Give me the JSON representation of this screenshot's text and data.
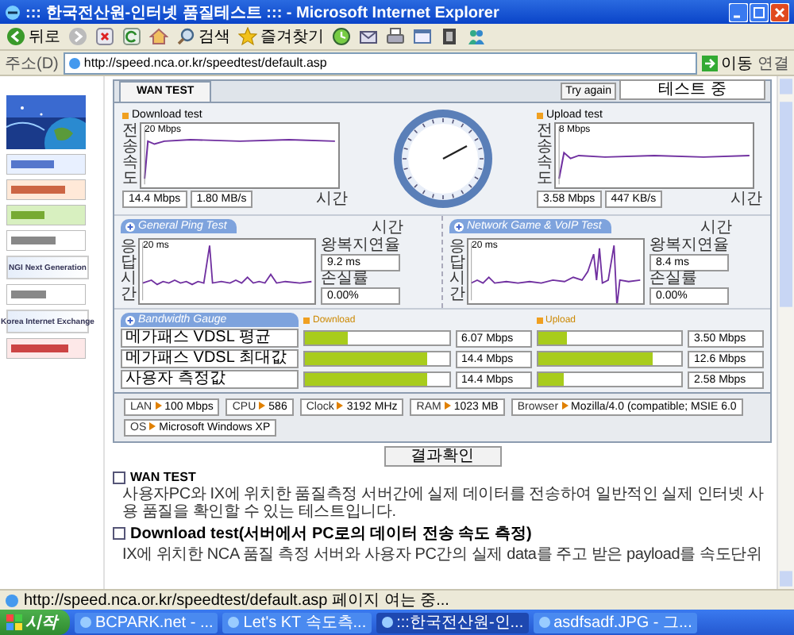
{
  "window": {
    "title": "::: 한국전산원-인터넷 품질테스트 ::: - Microsoft Internet Explorer"
  },
  "toolbar": {
    "items": [
      {
        "kind": "back",
        "label": "뒤로"
      },
      {
        "kind": "forward"
      },
      {
        "kind": "stop"
      },
      {
        "kind": "refresh"
      },
      {
        "kind": "home"
      },
      {
        "kind": "search",
        "label": "검색"
      },
      {
        "kind": "favorites",
        "label": "즐겨찾기"
      },
      {
        "kind": "history"
      },
      {
        "kind": "mail"
      },
      {
        "kind": "print"
      },
      {
        "kind": "edit"
      },
      {
        "kind": "media"
      },
      {
        "kind": "messenger"
      }
    ]
  },
  "address_bar": {
    "label": "주소(D)",
    "url": "http://speed.nca.or.kr/speedtest/default.asp",
    "go": "이동",
    "links": "연결"
  },
  "sidebar": {
    "banners": [
      {
        "kind": "picture"
      },
      {
        "kind": "banner"
      },
      {
        "kind": "banner"
      },
      {
        "kind": "banner"
      },
      {
        "kind": "banner"
      },
      {
        "kind": "banner",
        "text": "NGI Next Generation"
      },
      {
        "kind": "banner"
      },
      {
        "kind": "banner",
        "text": "Korea Internet Exchange"
      },
      {
        "kind": "banner"
      }
    ]
  },
  "test": {
    "tab": "WAN TEST",
    "retry": "Try again",
    "status": "테스트 중",
    "download": {
      "title": "Download test",
      "axis": "전송속도",
      "max": "20 Mbps",
      "xlabel": "시간",
      "speed": "14.4 Mbps",
      "rate": "1.80 MB/s"
    },
    "upload": {
      "title": "Upload test",
      "axis": "전송속도",
      "max": "8 Mbps",
      "xlabel": "시간",
      "speed": "3.58 Mbps",
      "rate": "447 KB/s"
    },
    "ping": [
      {
        "title": "General Ping Test",
        "axis": "응답시간",
        "max": "20 ms",
        "xlabel": "시간",
        "latency_label": "왕복지연율",
        "latency": "9.2 ms",
        "loss_label": "손실률",
        "loss": "0.00%"
      },
      {
        "title": "Network Game & VoIP Test",
        "axis": "응답시간",
        "max": "20 ms",
        "xlabel": "시간",
        "latency_label": "왕복지연율",
        "latency": "8.4 ms",
        "loss_label": "손실률",
        "loss": "0.00%"
      }
    ],
    "bandwidth": {
      "title": "Bandwidth Gauge",
      "download_header": "Download",
      "upload_header": "Upload",
      "rows": [
        {
          "name": "메가패스 VDSL 평균",
          "download": {
            "level": 0.3,
            "reading": "6.07 Mbps"
          },
          "upload": {
            "level": 0.2,
            "reading": "3.50 Mbps"
          }
        },
        {
          "name": "메가패스 VDSL 최대값",
          "download": {
            "level": 0.85,
            "reading": "14.4 Mbps"
          },
          "upload": {
            "level": 0.8,
            "reading": "12.6 Mbps"
          }
        },
        {
          "name": "사용자 측정값",
          "download": {
            "level": 0.85,
            "reading": "14.4 Mbps"
          },
          "upload": {
            "level": 0.18,
            "reading": "2.58 Mbps"
          }
        }
      ]
    },
    "system": [
      {
        "label": "LAN",
        "value": "100 Mbps"
      },
      {
        "label": "CPU",
        "value": "586"
      },
      {
        "label": "Clock",
        "value": "3192 MHz"
      },
      {
        "label": "RAM",
        "value": "1023 MB"
      },
      {
        "label": "Browser",
        "value": "Mozilla/4.0 (compatible; MSIE 6.0"
      },
      {
        "label": "OS",
        "value": "Microsoft Windows XP"
      }
    ],
    "result_button": "결과확인"
  },
  "notes": [
    {
      "heading": "WAN TEST",
      "text": "사용자PC와 IX에 위치한 품질측정 서버간에 실제 데이터를 전송하여 일반적인 실제 인터넷 사용 품질을 확인할 수 있는 테스트입니다."
    },
    {
      "heading": "Download test(서버에서 PC로의 데이터 전송 속도 측정)",
      "text": "IX에 위치한 NCA 품질 측정 서버와 사용자 PC간의 실제 data를 주고 받은 payload를 속도단위"
    }
  ],
  "status_bar": {
    "text": "http://speed.nca.or.kr/speedtest/default.asp 페이지 여는 중..."
  },
  "taskbar": {
    "start": "시작",
    "tasks": [
      {
        "label": "BCPARK.net - ...",
        "selected": false
      },
      {
        "label": "Let's KT 속도측...",
        "selected": false
      },
      {
        "label": ":::한국전산원-인...",
        "selected": true
      },
      {
        "label": "asdfsadf.JPG - 그...",
        "selected": false
      }
    ]
  }
}
